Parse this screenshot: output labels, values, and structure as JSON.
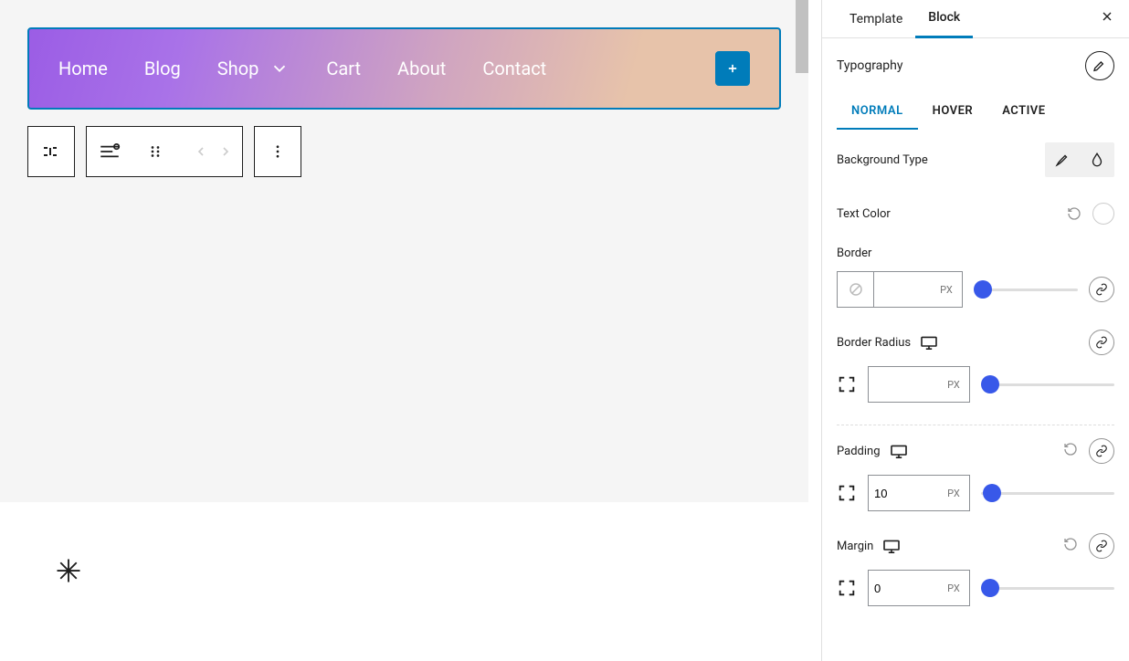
{
  "sidebar": {
    "tabs": {
      "template": "Template",
      "block": "Block"
    },
    "typography_label": "Typography",
    "state_tabs": {
      "normal": "NORMAL",
      "hover": "HOVER",
      "active": "ACTIVE"
    },
    "bg_type_label": "Background Type",
    "text_color_label": "Text Color",
    "border": {
      "label": "Border",
      "unit": "PX"
    },
    "border_radius": {
      "label": "Border Radius",
      "unit": "PX"
    },
    "padding": {
      "label": "Padding",
      "value": "10",
      "unit": "PX"
    },
    "margin": {
      "label": "Margin",
      "value": "0",
      "unit": "PX"
    }
  },
  "nav": {
    "items": [
      "Home",
      "Blog",
      "Shop",
      "Cart",
      "About",
      "Contact"
    ]
  }
}
